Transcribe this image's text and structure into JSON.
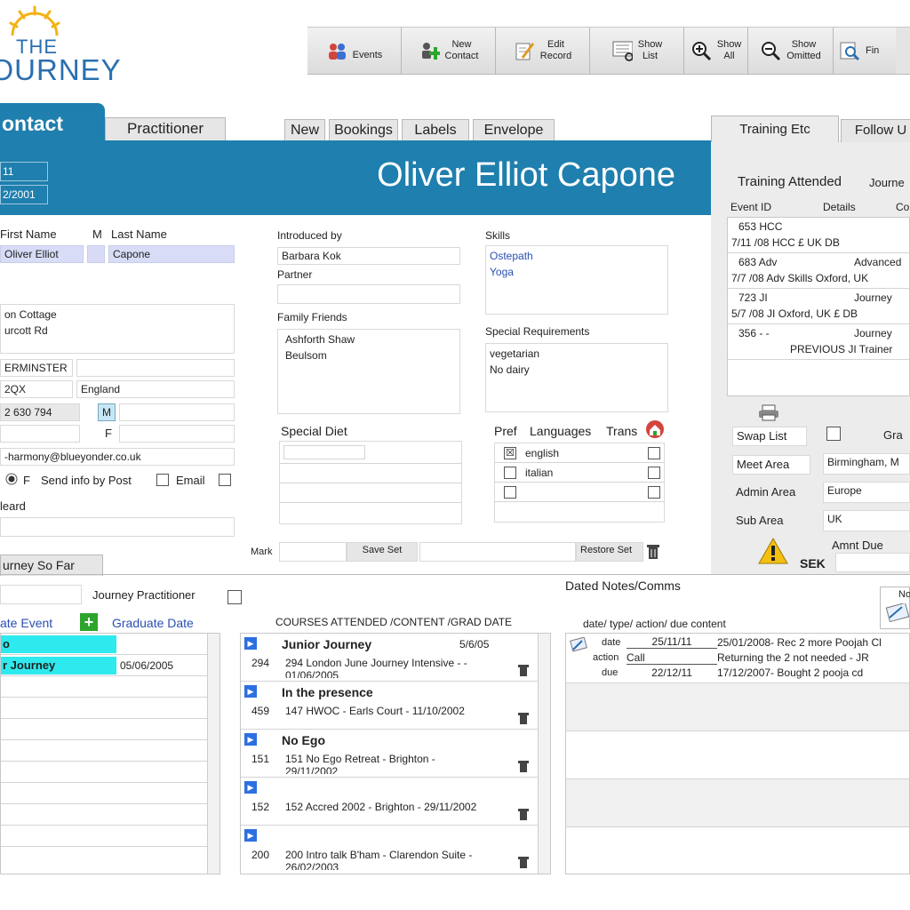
{
  "logo": {
    "line1": "THE",
    "line2": "JOURNEY"
  },
  "toolbar": [
    {
      "label": "Events",
      "icon": "people-icon"
    },
    {
      "label": "New\nContact",
      "icon": "add-user-icon"
    },
    {
      "label": "Edit\nRecord",
      "icon": "edit-icon"
    },
    {
      "label": "Show\nList",
      "icon": "list-icon"
    },
    {
      "label": "Show\nAll",
      "icon": "zoom-in-icon"
    },
    {
      "label": "Show\nOmitted",
      "icon": "zoom-out-icon"
    },
    {
      "label": "Fin",
      "icon": "find-icon"
    }
  ],
  "tabs": {
    "contact": "ontact",
    "practitioner": "Practitioner",
    "sub": [
      "New",
      "Bookings",
      "Labels",
      "Envelope"
    ],
    "right": [
      "Training Etc",
      "Follow U"
    ],
    "journey": "urney So Far"
  },
  "header": {
    "id1": "11",
    "id2": "2/2001",
    "name": "Oliver Elliot Capone"
  },
  "contact": {
    "first_label": "First Name",
    "m_label": "M",
    "last_label": "Last Name",
    "first": "Oliver Elliot",
    "last": "Capone",
    "address": "on Cottage\nurcott Rd",
    "town": "ERMINSTER",
    "postcode": "2QX",
    "country": "England",
    "phone": "2 630 794",
    "m_flag": "M",
    "f_flag": "F",
    "email": "-harmony@blueyonder.co.uk",
    "gender_f": "F",
    "send_info": "Send info by Post",
    "email_label": "Email",
    "heard": "leard"
  },
  "middle": {
    "introduced_label": "Introduced by",
    "introduced": "Barbara Kok",
    "partner_label": "Partner",
    "family_label": "Family Friends",
    "family": "Ashforth Shaw\nBeulsom",
    "diet_label": "Special Diet",
    "mark_label": "Mark",
    "save_set": "Save Set",
    "restore_set": "Restore Set"
  },
  "skills": {
    "label": "Skills",
    "value": "Ostepath\nYoga",
    "special_label": "Special Requirements",
    "special": "vegetarian\nNo dairy",
    "pref_label": "Pref",
    "lang_label": "Languages",
    "trans_label": "Trans",
    "languages": [
      {
        "name": "english",
        "pref": "☒"
      },
      {
        "name": "italian",
        "pref": ""
      },
      {
        "name": "",
        "pref": ""
      }
    ]
  },
  "training": {
    "title": "Training Attended",
    "title2": "Journe",
    "col_event": "Event ID",
    "col_details": "Details",
    "col_co": "Co",
    "rows": [
      {
        "line1a": "653 HCC",
        "line1b": "",
        "line2": "7/11 /08   HCC £ UK DB"
      },
      {
        "line1a": "683 Adv",
        "line1b": "Advanced",
        "line2": "7/7 /08   Adv Skills Oxford, UK"
      },
      {
        "line1a": "723 JI",
        "line1b": "Journey",
        "line2": "5/7 /08   JI Oxford, UK £ DB"
      },
      {
        "line1a": "356  -  -",
        "line1b": "Journey",
        "line2": "PREVIOUS JI Trainer"
      }
    ],
    "swap_list": "Swap List",
    "gra": "Gra",
    "meet_label": "Meet Area",
    "meet": "Birmingham, M",
    "admin_label": "Admin Area",
    "admin": "Europe",
    "sub_label": "Sub Area",
    "sub": "UK",
    "amnt_label": "Amnt Due",
    "currency": "SEK"
  },
  "journey": {
    "practitioner_label": "Journey Practitioner",
    "graduate_event": "ate Event",
    "graduate_date": "Graduate Date",
    "rows": [
      {
        "event": "o",
        "date": ""
      },
      {
        "event": "r Journey",
        "date": "05/06/2005"
      }
    ]
  },
  "courses": {
    "header": "COURSES ATTENDED  /CONTENT  /GRAD DATE",
    "items": [
      {
        "num": "294",
        "title": "Junior Journey",
        "date": "5/6/05",
        "desc": "294 London June Journey Intensive  -  -",
        "desc2": "01/06/2005"
      },
      {
        "num": "459",
        "title": "In the presence",
        "date": "",
        "desc": "147 HWOC - Earls Court - 11/10/2002",
        "desc2": ""
      },
      {
        "num": "151",
        "title": "No Ego",
        "date": "",
        "desc": "151 No Ego Retreat - Brighton -",
        "desc2": "29/11/2002"
      },
      {
        "num": "152",
        "title": "",
        "date": "",
        "desc": "152 Accred 2002 - Brighton - 29/11/2002",
        "desc2": ""
      },
      {
        "num": "200",
        "title": "",
        "date": "",
        "desc": "200 Intro talk B'ham - Clarendon Suite -",
        "desc2": "26/02/2003"
      }
    ]
  },
  "notes": {
    "title": "Dated Notes/Comms",
    "header": "date/ type/ action/ due     content",
    "no": "No",
    "date_label": "date",
    "date": "25/11/11",
    "action_label": "action",
    "action": "Call",
    "due_label": "due",
    "due": "22/12/11",
    "content": [
      "25/01/2008- Rec 2 more Poojah Cl",
      "Returning the 2 not needed - JR",
      "17/12/2007- Bought 2 pooja cd"
    ]
  }
}
